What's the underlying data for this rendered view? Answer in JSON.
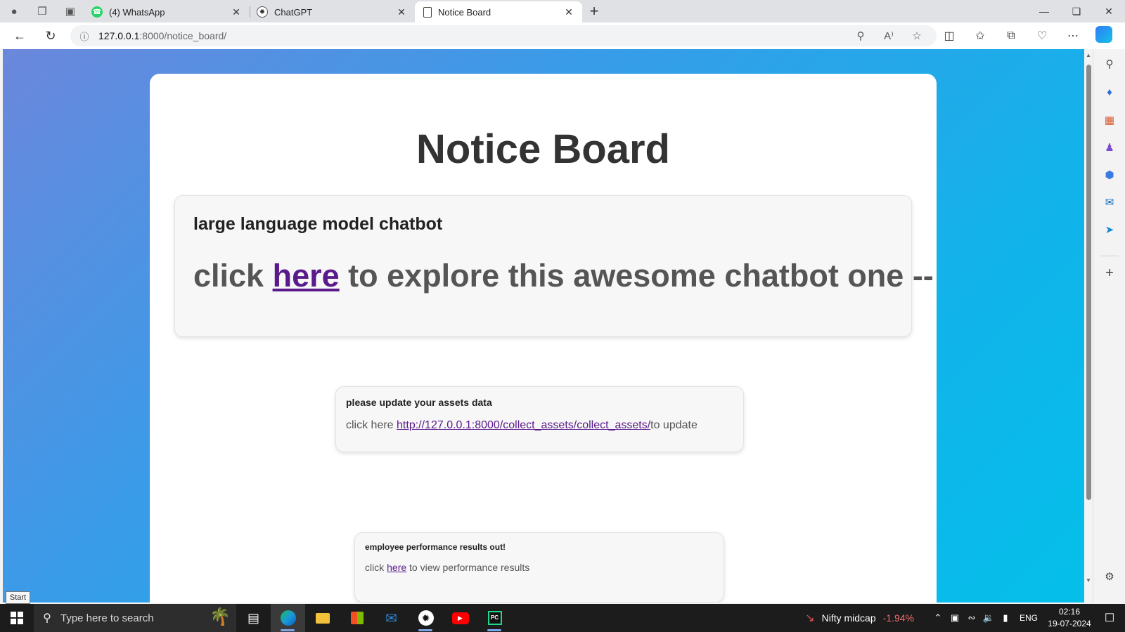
{
  "browser": {
    "tabs": [
      {
        "title": "(4) WhatsApp",
        "icon": "whatsapp-icon"
      },
      {
        "title": "ChatGPT",
        "icon": "chatgpt-icon"
      },
      {
        "title": "Notice Board",
        "icon": "document-icon",
        "active": true
      }
    ],
    "address": {
      "host": "127.0.0.1",
      "rest": ":8000/notice_board/"
    }
  },
  "page": {
    "title": "Notice Board",
    "notices": [
      {
        "heading": "large language model chatbot",
        "prefix": "click ",
        "link": "here",
        "suffix": " to explore this awesome chatbot one --"
      },
      {
        "heading": "please update your assets data",
        "prefix": "click here ",
        "link": "http://127.0.0.1:8000/collect_assets/collect_assets/",
        "suffix": "to update"
      },
      {
        "heading": "employee performance results out!",
        "prefix": "click ",
        "link": "here",
        "suffix": " to view performance results"
      }
    ]
  },
  "tooltip": "Start",
  "taskbar": {
    "search_placeholder": "Type here to search",
    "stock": {
      "name": "Nifty midcap",
      "change": "-1.94%"
    },
    "language": "ENG",
    "time": "02:16",
    "date": "19-07-2024"
  },
  "colors": {
    "link": "#5a1a8c",
    "gradient_start": "#6b87dc",
    "gradient_end": "#05bfea",
    "stock_down": "#f26b6b"
  }
}
